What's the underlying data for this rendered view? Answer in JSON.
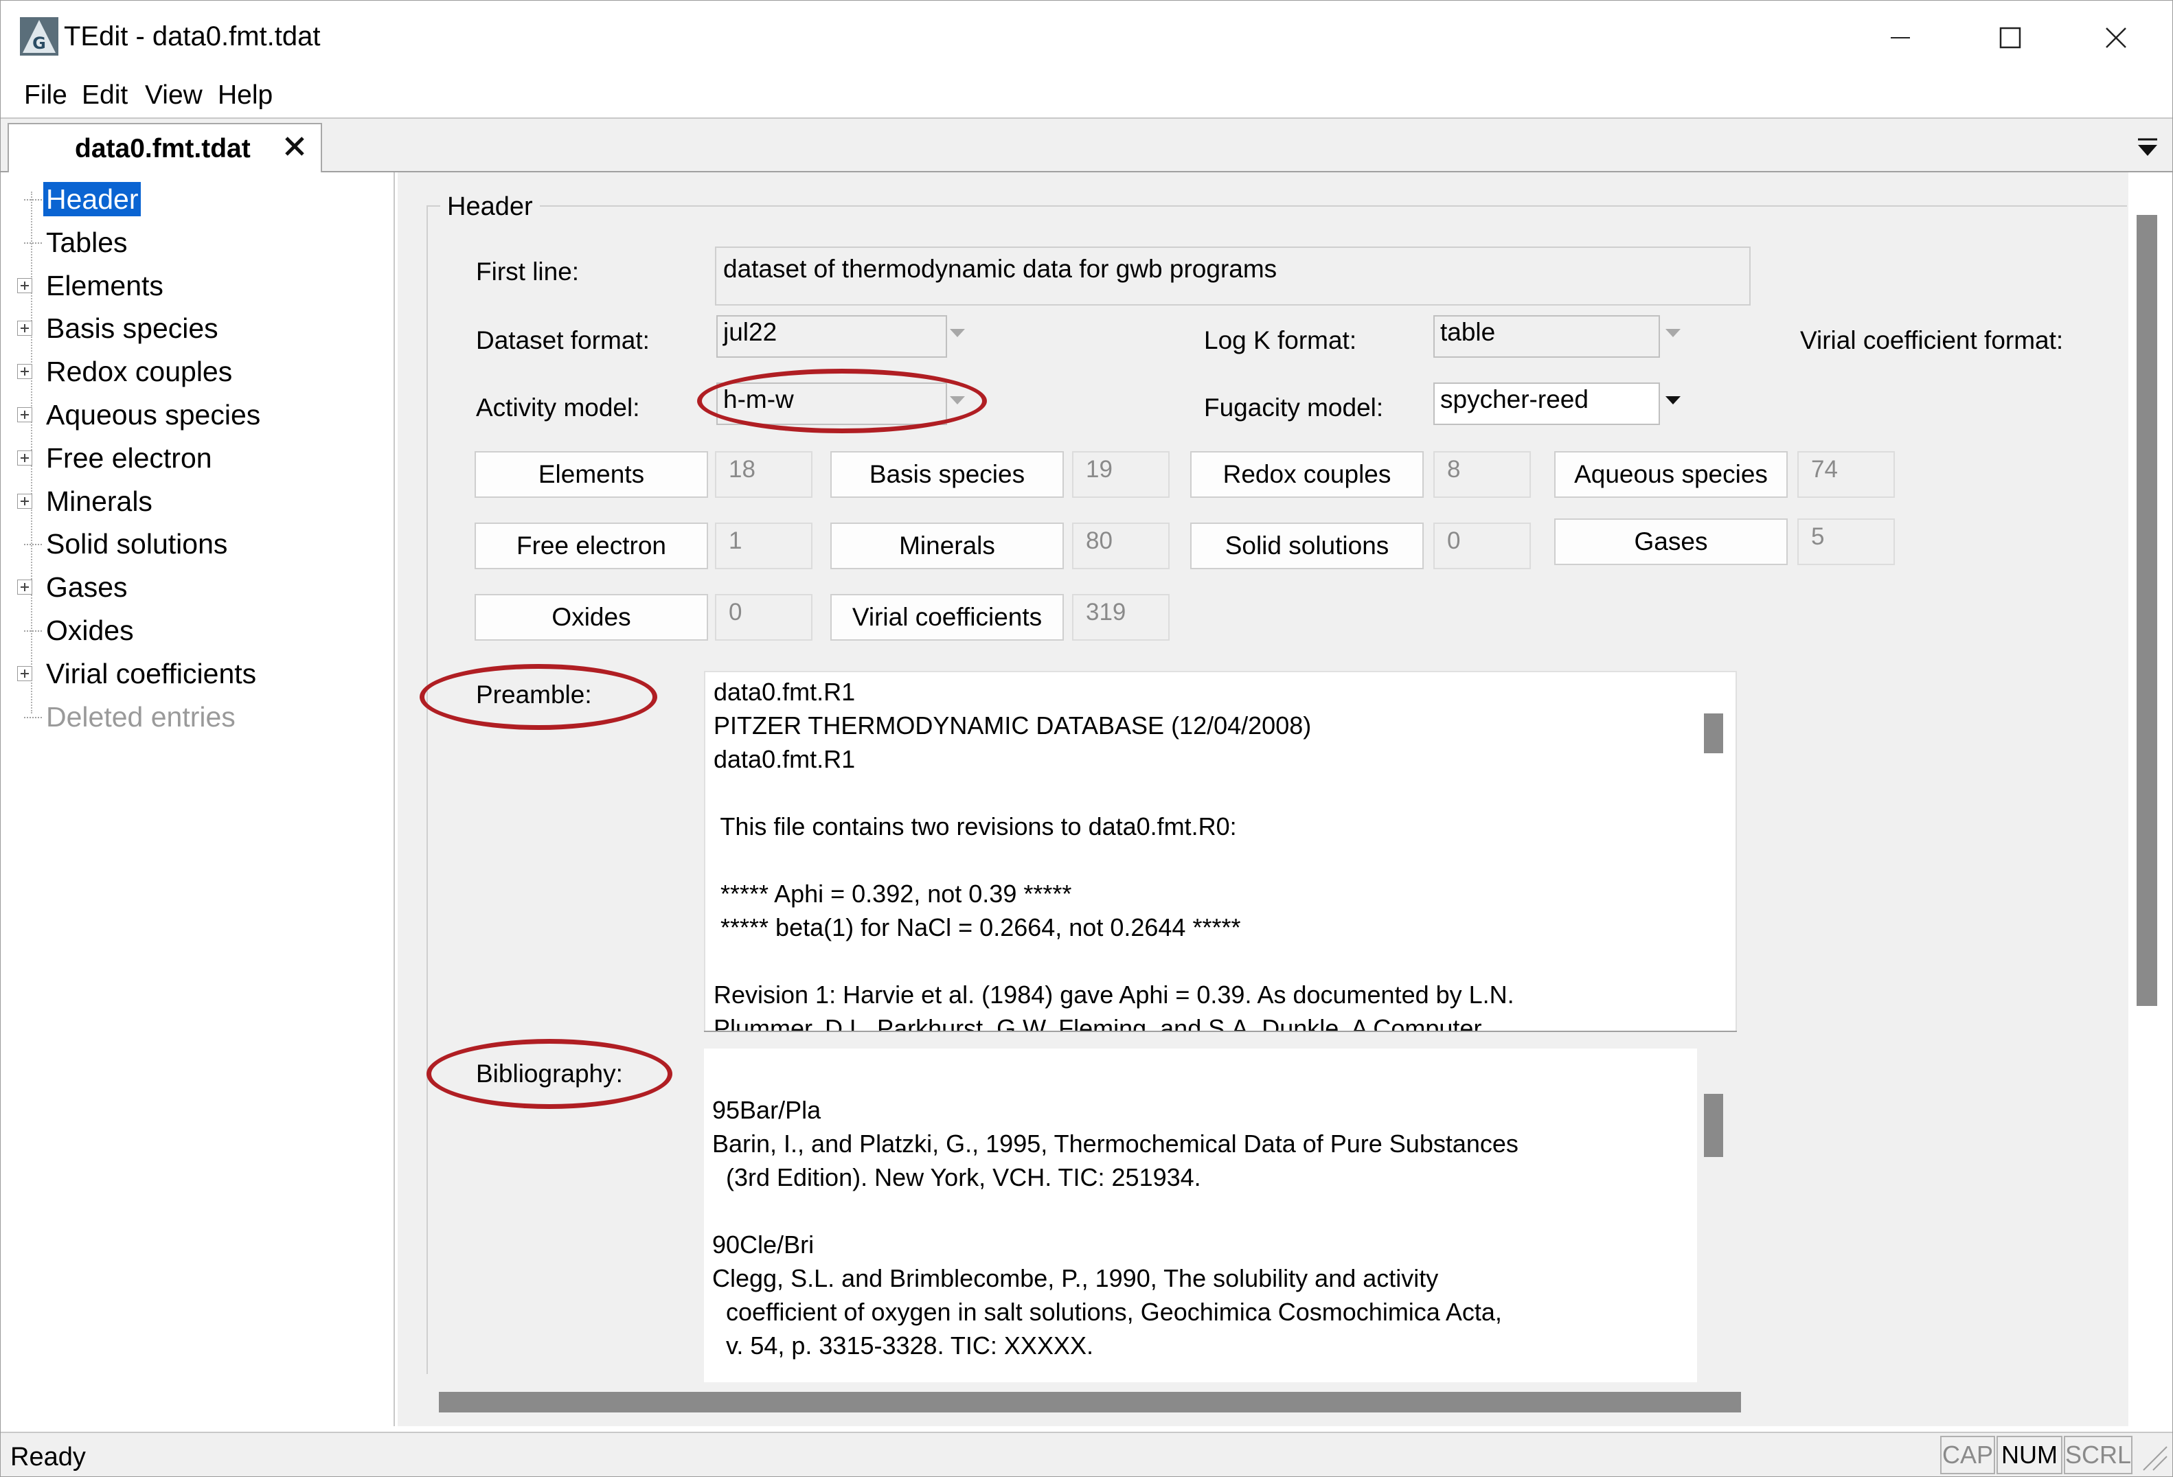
{
  "window": {
    "title": "TEdit - data0.fmt.tdat",
    "app_icon_letter": "G",
    "controls": [
      "minimize",
      "maximize",
      "close"
    ]
  },
  "menu": [
    "File",
    "Edit",
    "View",
    "Help"
  ],
  "tab": {
    "label": "data0.fmt.tdat",
    "close_glyph": "✕"
  },
  "tree": [
    {
      "label": "Header",
      "expandable": false,
      "selected": true
    },
    {
      "label": "Tables",
      "expandable": false
    },
    {
      "label": "Elements",
      "expandable": true
    },
    {
      "label": "Basis species",
      "expandable": true
    },
    {
      "label": "Redox couples",
      "expandable": true
    },
    {
      "label": "Aqueous species",
      "expandable": true
    },
    {
      "label": "Free electron",
      "expandable": true
    },
    {
      "label": "Minerals",
      "expandable": true
    },
    {
      "label": "Solid solutions",
      "expandable": false
    },
    {
      "label": "Gases",
      "expandable": true
    },
    {
      "label": "Oxides",
      "expandable": false
    },
    {
      "label": "Virial coefficients",
      "expandable": true
    },
    {
      "label": "Deleted entries",
      "expandable": false,
      "disabled": true
    }
  ],
  "header": {
    "group_title": "Header",
    "first_line_label": "First line:",
    "first_line_value": "dataset of thermodynamic data for gwb programs",
    "dataset_format_label": "Dataset format:",
    "dataset_format_value": "jul22",
    "logk_format_label": "Log K format:",
    "logk_format_value": "table",
    "virial_format_label": "Virial coefficient format:",
    "activity_model_label": "Activity model:",
    "activity_model_value": "h-m-w",
    "fugacity_model_label": "Fugacity model:",
    "fugacity_model_value": "spycher-reed",
    "counts": [
      {
        "label": "Elements",
        "value": "18"
      },
      {
        "label": "Basis species",
        "value": "19"
      },
      {
        "label": "Redox couples",
        "value": "8"
      },
      {
        "label": "Aqueous species",
        "value": "74"
      },
      {
        "label": "Free electron",
        "value": "1"
      },
      {
        "label": "Minerals",
        "value": "80"
      },
      {
        "label": "Solid solutions",
        "value": "0"
      },
      {
        "label": "Gases",
        "value": "5"
      },
      {
        "label": "Oxides",
        "value": "0"
      },
      {
        "label": "Virial coefficients",
        "value": "319"
      }
    ],
    "preamble_label": "Preamble:",
    "preamble_lines": [
      "data0.fmt.R1",
      "PITZER THERMODYNAMIC DATABASE (12/04/2008)",
      "data0.fmt.R1",
      "",
      " This file contains two revisions to data0.fmt.R0:",
      "",
      " ***** Aphi = 0.392, not 0.39 *****",
      " ***** beta(1) for NaCl = 0.2664, not 0.2644 *****",
      "",
      "Revision 1: Harvie et al. (1984) gave Aphi = 0.39. As documented by L.N.",
      "Plummer, D.L. Parkhurst, G.W. Fleming, and S.A. Dunkle, A Computer"
    ],
    "bibliography_label": "Bibliography:",
    "bibliography_lines": [
      "",
      "95Bar/Pla",
      "Barin, I., and Platzki, G., 1995, Thermochemical Data of Pure Substances",
      "  (3rd Edition). New York, VCH. TIC: 251934.",
      "",
      "90Cle/Bri",
      "Clegg, S.L. and Brimblecombe, P., 1990, The solubility and activity",
      "  coefficient of oxygen in salt solutions, Geochimica Cosmochimica Acta,",
      "  v. 54, p. 3315-3328. TIC: XXXXX."
    ]
  },
  "status": {
    "text": "Ready",
    "indicators": [
      {
        "label": "CAP",
        "active": false
      },
      {
        "label": "NUM",
        "active": true
      },
      {
        "label": "SCRL",
        "active": false
      }
    ]
  },
  "colors": {
    "selection": "#0a64d2",
    "annotation": "#b01e23",
    "panel": "#f0f0f0"
  }
}
